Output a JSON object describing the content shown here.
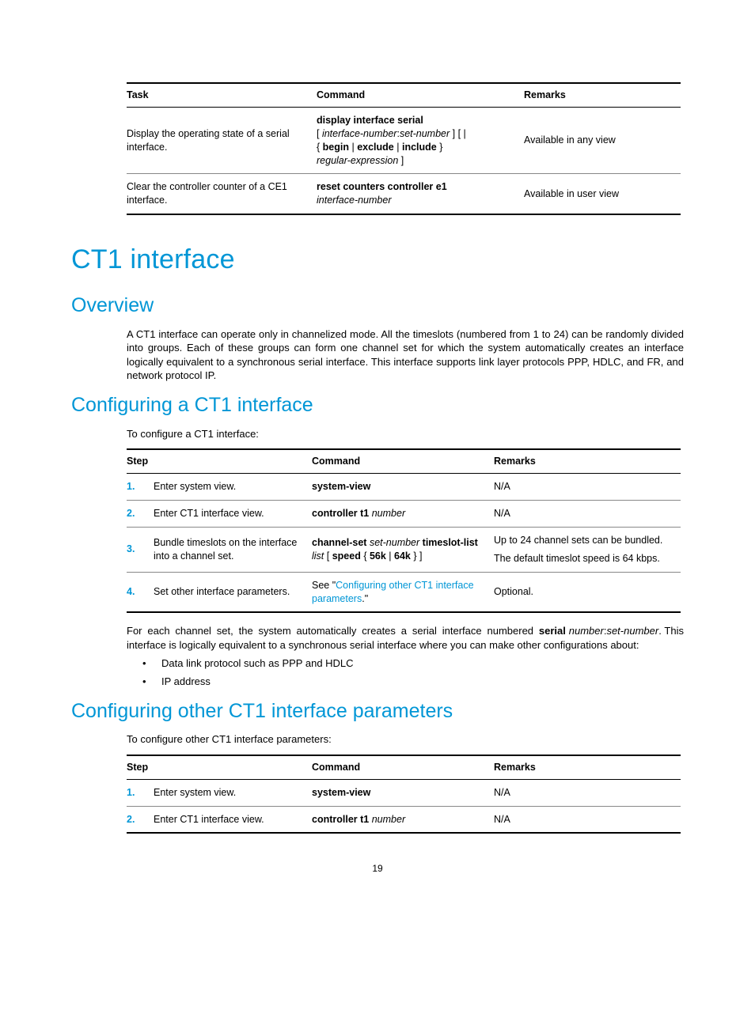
{
  "table1": {
    "headers": {
      "task": "Task",
      "command": "Command",
      "remarks": "Remarks"
    },
    "rows": [
      {
        "task": "Display the operating state of a serial interface.",
        "cmd_b1": "display interface serial",
        "cmd_i1": "interface-number",
        "cmd_i1b": "set-number",
        "cmd_b2": "begin",
        "cmd_b3": "exclude",
        "cmd_b4": "include",
        "cmd_i2": "regular-expression",
        "remarks": "Available in any view"
      },
      {
        "task": "Clear the controller counter of a CE1 interface.",
        "cmd_b1": "reset counters controller e1",
        "cmd_i1": "interface-number",
        "remarks": "Available in user view"
      }
    ]
  },
  "h1": "CT1 interface",
  "h2_overview": "Overview",
  "p_overview": "A CT1 interface can operate only in channelized mode. All the timeslots (numbered from 1 to 24) can be randomly divided into groups. Each of these groups can form one channel set for which the system automatically creates an interface logically equivalent to a synchronous serial interface. This interface supports link layer protocols PPP, HDLC, and FR, and network protocol IP.",
  "h2_config": "Configuring a CT1 interface",
  "p_config_lead": "To configure a CT1 interface:",
  "table2": {
    "headers": {
      "step": "Step",
      "command": "Command",
      "remarks": "Remarks"
    },
    "rows": {
      "r1": {
        "n": "1.",
        "step": "Enter system view.",
        "cmd_b": "system-view",
        "remarks": "N/A"
      },
      "r2": {
        "n": "2.",
        "step": "Enter CT1 interface view.",
        "cmd_b": "controller t1",
        "cmd_i": "number",
        "remarks": "N/A"
      },
      "r3": {
        "n": "3.",
        "step": "Bundle timeslots on the interface into a channel set.",
        "cmd_b1": "channel-set",
        "cmd_i1": "set-number",
        "cmd_b2": "timeslot-list",
        "cmd_i2": "list",
        "cmd_b3": "speed",
        "cmd_b4": "56k",
        "cmd_b5": "64k",
        "rem1": "Up to 24 channel sets can be bundled.",
        "rem2": "The default timeslot speed is 64 kbps."
      },
      "r4": {
        "n": "4.",
        "step": "Set other interface parameters.",
        "cmd_pre": "See \"",
        "cmd_link": "Configuring other CT1 interface parameters",
        "cmd_post": ".\"",
        "remarks": "Optional."
      }
    }
  },
  "p_after_t2_1a": "For each channel set, the system automatically creates a serial interface numbered ",
  "p_after_t2_1b": "serial",
  "p_after_t2_2a": "number",
  "p_after_t2_2b": "set-number",
  "p_after_t2_2c": ". This interface is logically equivalent to a synchronous serial interface where you can make other configurations about:",
  "bullets": {
    "b1": "Data link protocol such as PPP and HDLC",
    "b2": "IP address"
  },
  "h2_other": "Configuring other CT1 interface parameters",
  "p_other_lead": "To configure other CT1 interface parameters:",
  "table3": {
    "headers": {
      "step": "Step",
      "command": "Command",
      "remarks": "Remarks"
    },
    "rows": {
      "r1": {
        "n": "1.",
        "step": "Enter system view.",
        "cmd_b": "system-view",
        "remarks": "N/A"
      },
      "r2": {
        "n": "2.",
        "step": "Enter CT1 interface view.",
        "cmd_b": "controller t1",
        "cmd_i": "number",
        "remarks": "N/A"
      }
    }
  },
  "pagenum": "19"
}
